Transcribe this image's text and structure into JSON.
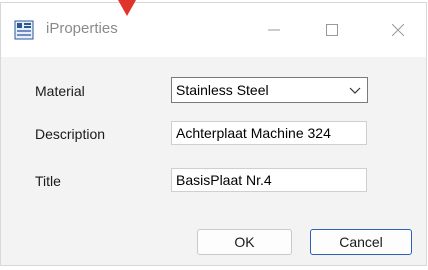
{
  "window": {
    "title": "iProperties",
    "app_icon": "inventor-iproperties-icon",
    "controls": [
      "minimize-icon",
      "maximize-icon",
      "close-icon"
    ]
  },
  "form": {
    "material_label": "Material",
    "material_value": "Stainless Steel",
    "description_label": "Description",
    "description_value": "Achterplaat Machine 324",
    "title_label": "Title",
    "title_value": "BasisPlaat Nr.4"
  },
  "buttons": {
    "ok_label": "OK",
    "cancel_label": "Cancel"
  },
  "colors": {
    "cursor_marker": "#e0332b",
    "focus_border": "#2a61b9"
  }
}
